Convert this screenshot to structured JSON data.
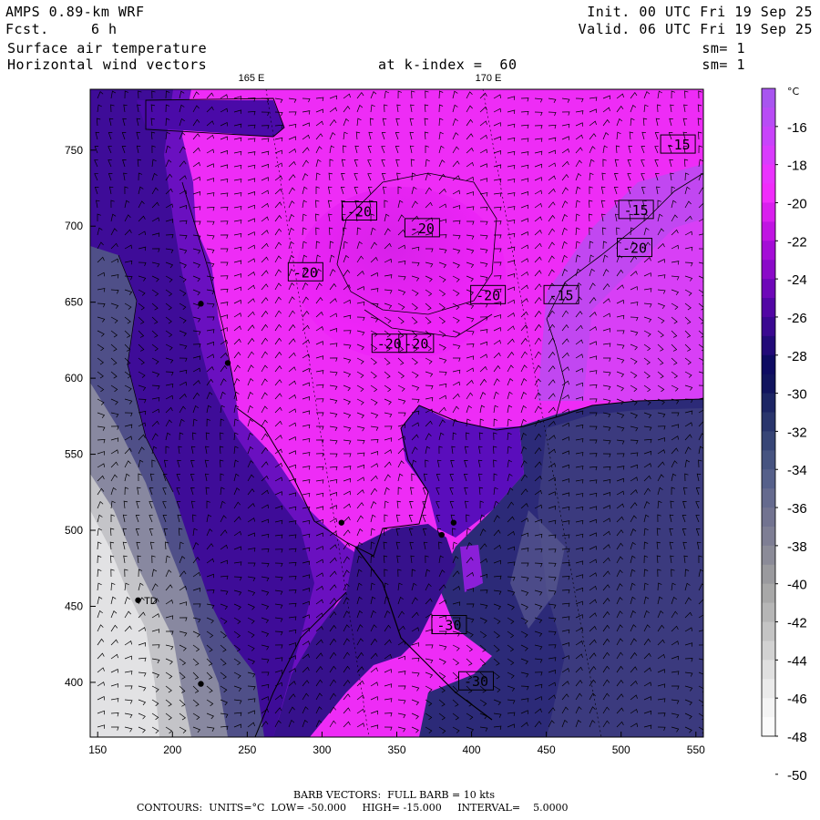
{
  "header": {
    "model": "AMPS 0.89-km WRF",
    "fcst_label": "Fcst.",
    "fcst_value": "6 h",
    "field1": "Surface air temperature",
    "field2": "Horizontal wind vectors",
    "level": "at k-index =  60",
    "init": "Init. 00 UTC Fri 19 Sep 25",
    "valid": "Valid. 06 UTC Fri 19 Sep 25",
    "sm1": "sm= 1",
    "sm2": "sm= 1"
  },
  "map": {
    "lon_labels": [
      "165 E",
      "170 E"
    ],
    "x_ticks": [
      150,
      200,
      250,
      300,
      350,
      400,
      450,
      500,
      550
    ],
    "y_ticks": [
      400,
      450,
      500,
      550,
      600,
      650,
      700,
      750
    ],
    "x_range": [
      145,
      555
    ],
    "y_range": [
      364,
      790
    ],
    "contour_labels": [
      {
        "text": "-20",
        "x": 325,
        "y": 710
      },
      {
        "text": "-20",
        "x": 367,
        "y": 699
      },
      {
        "text": "-20",
        "x": 289,
        "y": 670
      },
      {
        "text": "-20",
        "x": 411,
        "y": 655
      },
      {
        "text": "-20",
        "x": 345,
        "y": 623
      },
      {
        "text": "-20",
        "x": 363,
        "y": 623
      },
      {
        "text": "-15",
        "x": 538,
        "y": 754
      },
      {
        "text": "-15",
        "x": 510,
        "y": 711
      },
      {
        "text": "-15",
        "x": 460,
        "y": 655
      },
      {
        "text": "-20",
        "x": 509,
        "y": 686
      },
      {
        "text": "-30",
        "x": 385,
        "y": 438
      },
      {
        "text": "-30",
        "x": 403,
        "y": 401
      }
    ],
    "stations": [
      {
        "x": 219,
        "y": 649
      },
      {
        "x": 237,
        "y": 610
      },
      {
        "x": 313,
        "y": 505
      },
      {
        "x": 380,
        "y": 497
      },
      {
        "x": 388,
        "y": 505
      },
      {
        "x": 177,
        "y": 454
      },
      {
        "x": 219,
        "y": 399
      }
    ],
    "station_label": {
      "text": "TD",
      "x": 181,
      "y": 454
    }
  },
  "colorbar": {
    "unit": "°C",
    "labels": [
      "-16",
      "-18",
      "-20",
      "-22",
      "-24",
      "-26",
      "-28",
      "-30",
      "-32",
      "-34",
      "-36",
      "-38",
      "-40",
      "-42",
      "-44",
      "-46",
      "-48",
      "-50"
    ],
    "colors": [
      "#a855ef",
      "#b84cf5",
      "#c843fa",
      "#d93bfd",
      "#ea33fe",
      "#f02cfb",
      "#d91fee",
      "#c014e2",
      "#a40dd6",
      "#8a0ac8",
      "#6e07b8",
      "#5206a4",
      "#3a0890",
      "#220a78",
      "#0e0b62",
      "#11145e",
      "#1c2564",
      "#29356c",
      "#374576",
      "#465380",
      "#56608a",
      "#656a8e",
      "#727390",
      "#7e7e94",
      "#8b8b98",
      "#9a9a9e",
      "#a8a8a8",
      "#b6b6b6",
      "#c4c4c4",
      "#d2d2d2",
      "#e0e0e0",
      "#ebebeb",
      "#f4f4f4",
      "#fbfbfb"
    ]
  },
  "footer": {
    "line1": "BARB VECTORS:  FULL BARB = 10 kts",
    "line2": "CONTOURS:  UNITS=°C  LOW= -50.000     HIGH= -15.000     INTERVAL=    5.0000"
  }
}
